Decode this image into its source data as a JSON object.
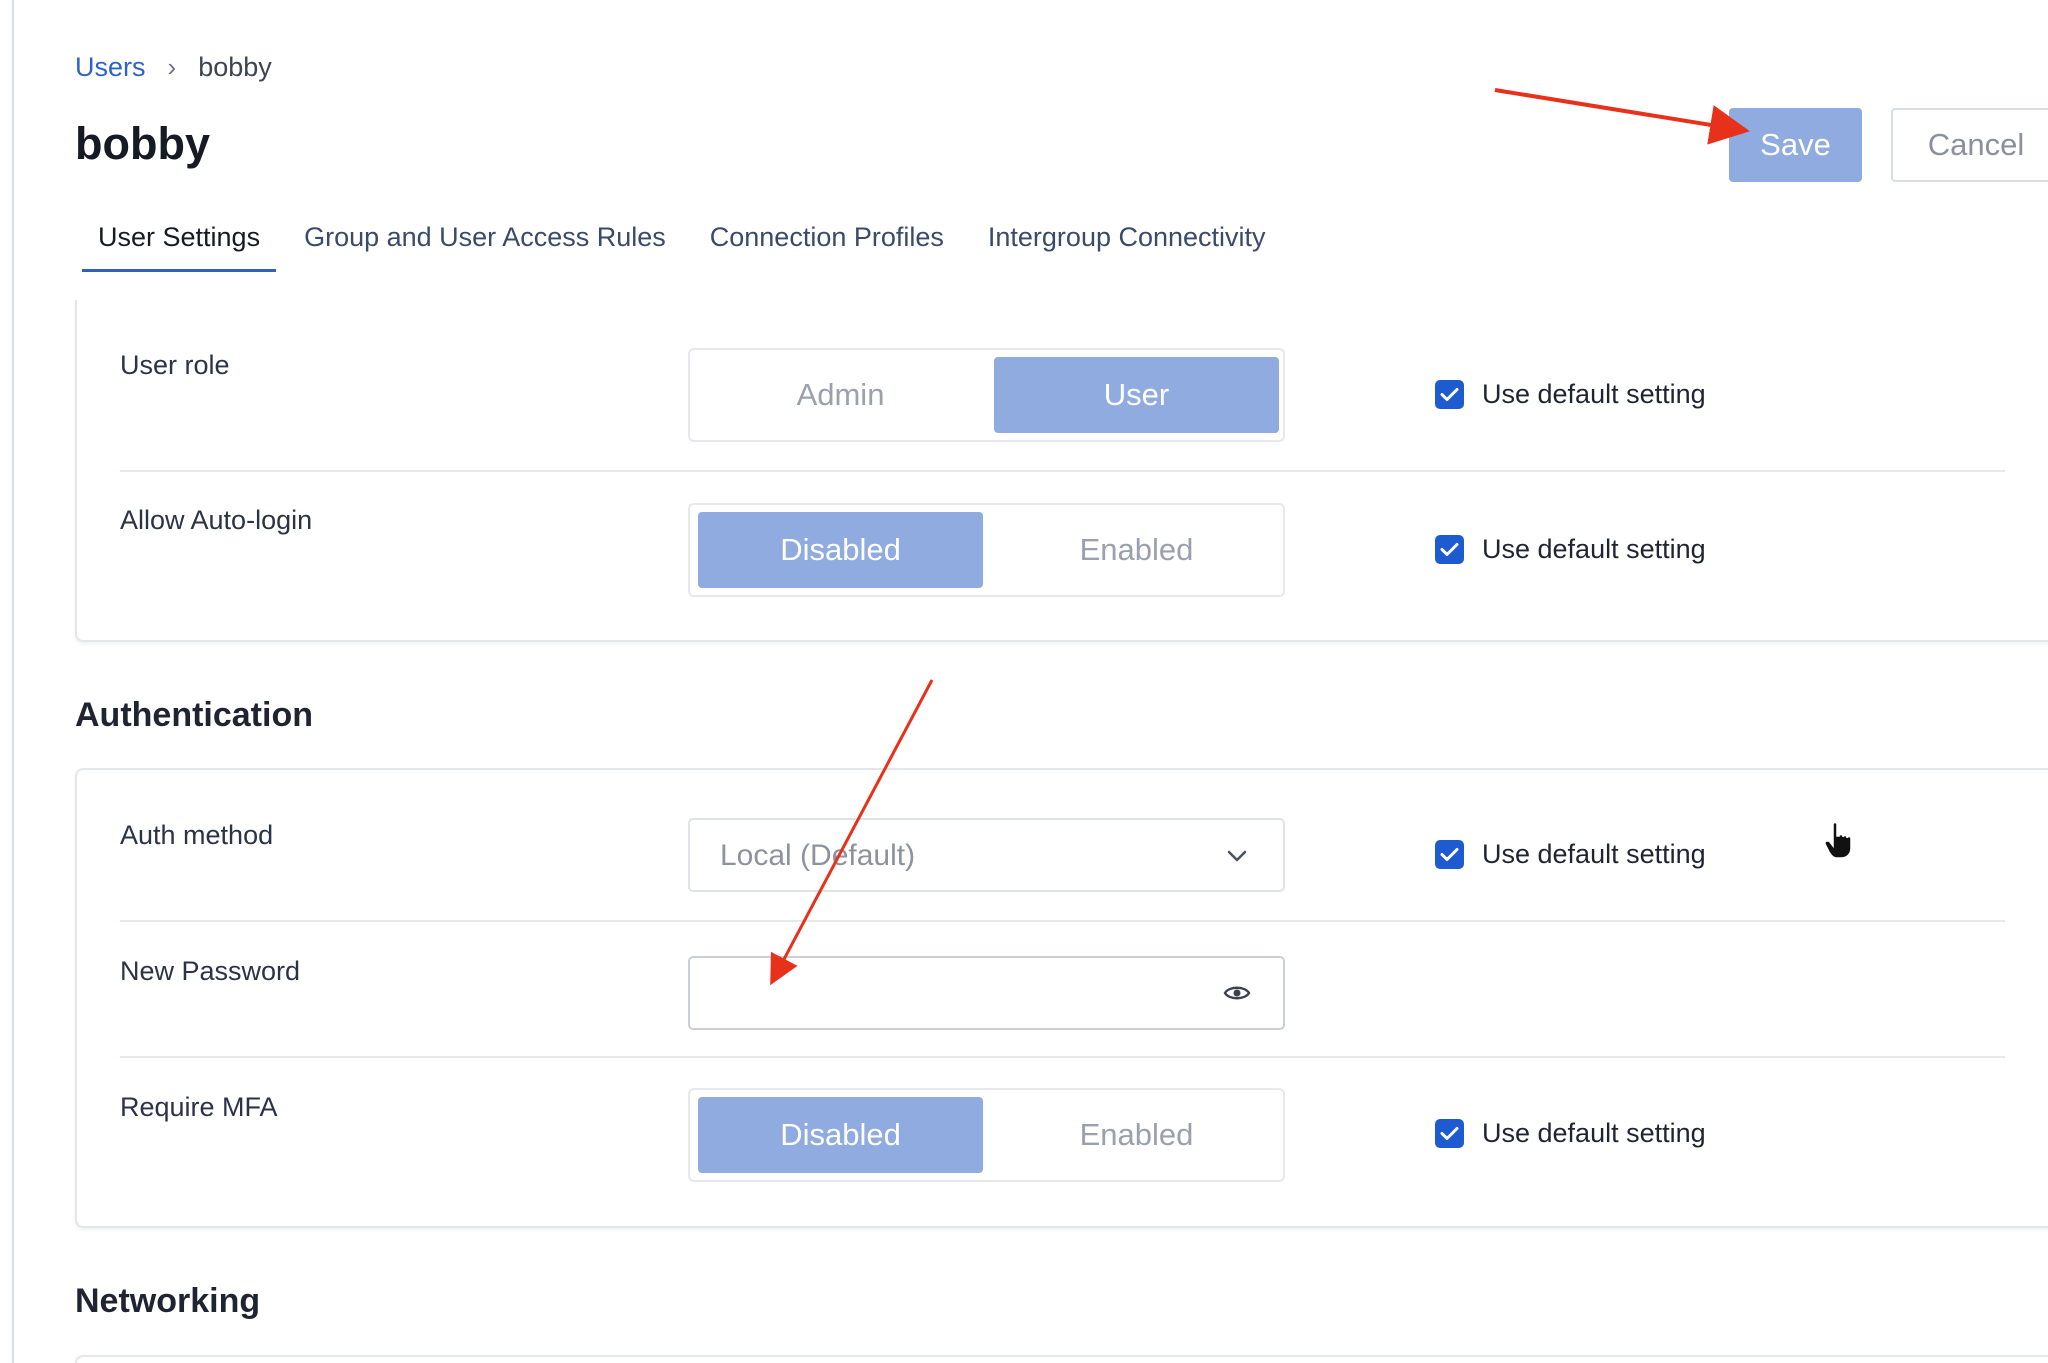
{
  "breadcrumb": {
    "parent": "Users",
    "separator": "›",
    "current": "bobby"
  },
  "page": {
    "title": "bobby"
  },
  "actions": {
    "save_label": "Save",
    "cancel_label": "Cancel"
  },
  "tabs": [
    {
      "label": "User Settings",
      "active": true
    },
    {
      "label": "Group and User Access Rules",
      "active": false
    },
    {
      "label": "Connection Profiles",
      "active": false
    },
    {
      "label": "Intergroup Connectivity",
      "active": false
    }
  ],
  "user_section": {
    "user_role": {
      "label": "User role",
      "options": [
        "Admin",
        "User"
      ],
      "selected": "User",
      "default_label": "Use default setting",
      "use_default": true
    },
    "auto_login": {
      "label": "Allow Auto-login",
      "options": [
        "Disabled",
        "Enabled"
      ],
      "selected": "Disabled",
      "default_label": "Use default setting",
      "use_default": true
    }
  },
  "authentication": {
    "title": "Authentication",
    "auth_method": {
      "label": "Auth method",
      "value": "Local (Default)",
      "default_label": "Use default setting",
      "use_default": true
    },
    "new_password": {
      "label": "New Password",
      "value": ""
    },
    "require_mfa": {
      "label": "Require MFA",
      "options": [
        "Disabled",
        "Enabled"
      ],
      "selected": "Disabled",
      "default_label": "Use default setting",
      "use_default": true
    }
  },
  "networking": {
    "title": "Networking"
  },
  "colors": {
    "accent": "#1f5bd0",
    "selected_segment": "#8fabdf",
    "link": "#2f63c5",
    "annotation_arrow": "#e8311a"
  },
  "icons": {
    "breadcrumb_separator": "chevron-right-icon",
    "select_chevron": "chevron-down-icon",
    "password_toggle": "eye-icon",
    "checkbox": "checkmark-icon"
  }
}
